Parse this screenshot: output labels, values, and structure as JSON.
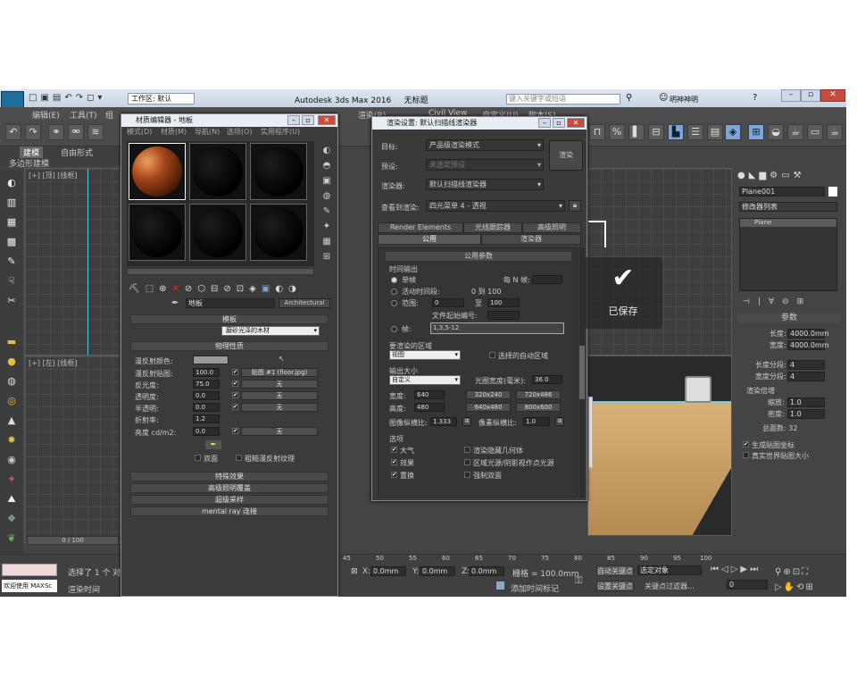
{
  "app": {
    "title": "Autodesk 3ds Max 2016",
    "file": "无标题",
    "workspace": "工作区: 默认",
    "search_placeholder": "键入关键字或短语",
    "user": "明神神明",
    "logo": "MAX"
  },
  "menu": [
    "编辑(E)",
    "工具(T)",
    "组"
  ],
  "menu_right": [
    "渲染(R)",
    "Civil View",
    "自定义(U)",
    "脚本(S)"
  ],
  "ribbon": {
    "tabs": [
      "建模",
      "自由形式"
    ],
    "sub": "多边形建模"
  },
  "viewports": {
    "top": "[+] [顶] [线框]",
    "front": "[+] [左] [线框]",
    "frame": "0 / 100"
  },
  "saved": "已保存",
  "material_editor": {
    "title": "材质编辑器 - 地板",
    "menu": [
      "模式(D)",
      "材质(M)",
      "导航(N)",
      "选项(O)",
      "实用程序(U)"
    ],
    "material_name": "地板",
    "material_type": "Architectural",
    "template_label": "模板",
    "template_value": "磨砂光泽的木材",
    "physical": "物理性质",
    "labels": [
      "漫反射颜色:",
      "漫反射贴图:",
      "反光度:",
      "透明度:",
      "半透明:",
      "折射率:",
      "亮度 cd/m2:"
    ],
    "values": [
      "",
      "100.0",
      "75.0",
      "0.0",
      "0.0",
      "1.2",
      "0.0"
    ],
    "map_buttons": [
      "贴图 #1 (floor.jpg)",
      "无",
      "无",
      "无",
      "",
      "无"
    ],
    "double_side": "双面",
    "rough": "粗糙漫反射纹理",
    "rollouts": [
      "特殊效果",
      "高级照明覆盖",
      "超级采样",
      "mental ray 连接"
    ]
  },
  "render_setup": {
    "title": "渲染设置: 默认扫描线渲染器",
    "labels": [
      "目标:",
      "预设:",
      "渲染器:",
      "查看到渲染:"
    ],
    "target": "产品级渲染模式",
    "preset": "未选定预设",
    "renderer": "默认扫描线渲染器",
    "view": "四元菜单 4 - 透视",
    "render_button": "渲染",
    "tabs_row1": [
      "Render Elements",
      "光线跟踪器",
      "高级照明"
    ],
    "tabs_row2": [
      "公用",
      "渲染器"
    ],
    "common_params": "公用参数",
    "time_output": "时间输出",
    "single": "单帧",
    "every_n": "每 N 帧:",
    "active": "活动时间段:",
    "active_range": "0 到 100",
    "range": "范围:",
    "range_from": "0",
    "to": "至",
    "range_to": "100",
    "file_num": "文件起始编号:",
    "frames": "帧:",
    "frames_val": "1,3,5-12",
    "area": "要渲染的区域",
    "area_val": "视图",
    "auto_area": "选择的自动区域",
    "output_size": "输出大小",
    "size_mode": "自定义",
    "aperture": "光圈宽度(毫米):",
    "aperture_val": "36.0",
    "width": "宽度:",
    "width_val": "640",
    "height": "高度:",
    "height_val": "480",
    "presets": [
      "320x240",
      "720x486",
      "640x480",
      "800x600"
    ],
    "img_aspect": "图像纵横比:",
    "img_aspect_val": "1.333",
    "px_aspect": "像素纵横比:",
    "px_aspect_val": "1.0",
    "options": "选项",
    "opts": [
      "大气",
      "效果",
      "置换",
      "渲染隐藏几何体",
      "区域光源/阴影视作点光源",
      "强制双面"
    ]
  },
  "command_panel": {
    "object": "Plane001",
    "modifier_list": "修改器列表",
    "stack_item": "Plane",
    "params": "参数",
    "length": "长度:",
    "length_val": "4000.0mm",
    "width": "宽度:",
    "width_val": "4000.0mm",
    "lseg": "长度分段:",
    "lseg_val": "4",
    "wseg": "宽度分段:",
    "wseg_val": "4",
    "render_mult": "渲染倍增",
    "scale": "缩放:",
    "scale_val": "1.0",
    "density": "密度:",
    "density_val": "1.0",
    "faces": "总面数: 32",
    "gen_map": "生成贴图坐标",
    "real_world": "真实世界贴图大小"
  },
  "status": {
    "selected": "选择了 1 个 对象",
    "welcome": "欢迎使用 MAXSc",
    "render_time": "渲染时间",
    "x": "0.0mm",
    "y": "0.0mm",
    "z": "0.0mm",
    "grid": "栅格 = 100.0mm",
    "add_key": "添加时间标记",
    "auto_key": "自动关键点",
    "set_key": "设置关键点",
    "selected_obj": "选定对象",
    "key_filter": "关键点过滤器...",
    "frame_num": "0",
    "ticks": [
      "45",
      "50",
      "55",
      "60",
      "65",
      "70",
      "75",
      "80",
      "85",
      "90",
      "95",
      "100"
    ]
  }
}
